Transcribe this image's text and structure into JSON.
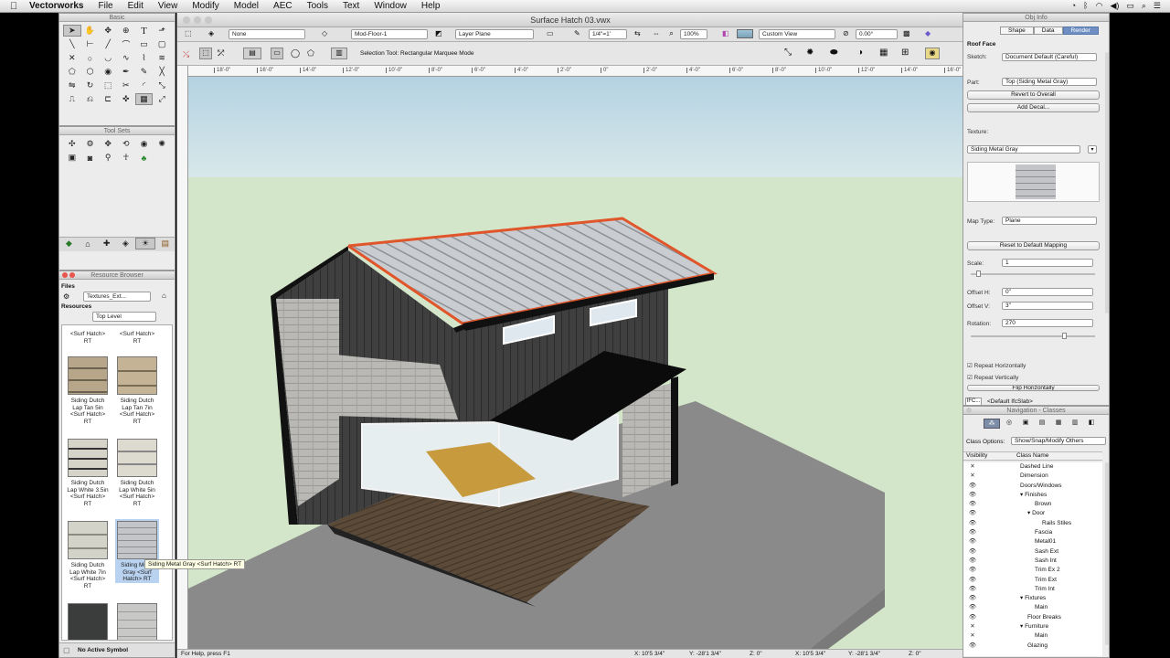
{
  "menubar": {
    "app_name": "Vectorworks",
    "items": [
      "File",
      "Edit",
      "View",
      "Modify",
      "Model",
      "AEC",
      "Tools",
      "Text",
      "Window",
      "Help"
    ]
  },
  "basic_palette": {
    "title": "Basic"
  },
  "tool_sets": {
    "title": "Tool Sets"
  },
  "resource_browser": {
    "title": "Resource Browser",
    "files_label": "Files",
    "files_value": "Textures_Ext...",
    "resources_label": "Resources",
    "resources_value": "Top Level",
    "items": [
      {
        "label": "Siding Dutch Lap Tan 5in <Surf Hatch> RT",
        "color": "#b7a68a"
      },
      {
        "label": "Siding Dutch Lap Tan 7in <Surf Hatch> RT",
        "color": "#c4b394"
      },
      {
        "label": "Siding Dutch Lap White 3.5in <Surf Hatch> RT",
        "color": "#d6d4c8"
      },
      {
        "label": "Siding Dutch Lap White 5in <Surf Hatch> RT",
        "color": "#dddbd0"
      },
      {
        "label": "Siding Dutch Lap White 7in <Surf Hatch> RT",
        "color": "#d4d3c9"
      },
      {
        "label": "Siding Metal Gray <Surf Hatch> RT",
        "color": "#bfc1c4"
      }
    ],
    "top_partial": "<Surf Hatch> RT",
    "tooltip": "Siding Metal Gray <Surf Hatch> RT",
    "active_symbol": "No Active Symbol"
  },
  "document": {
    "title": "Surface Hatch 03.vwx",
    "class_field": "None",
    "layer_field": "Mod-Floor-1",
    "plane_field": "Layer Plane",
    "scale_field": "1/4\"=1'",
    "zoom_field": "100%",
    "view_field": "Custom View",
    "angle_field": "0.00°",
    "mode_text": "Selection Tool: Rectangular Marquee Mode",
    "ruler_ticks": [
      "18'-0\"",
      "16'-0\"",
      "14'-0\"",
      "12'-0\"",
      "10'-0\"",
      "8'-0\"",
      "6'-0\"",
      "4'-0\"",
      "2'-0\"",
      "0\"",
      "2'-0\"",
      "4'-0\"",
      "6'-0\"",
      "8'-0\"",
      "10'-0\"",
      "12'-0\"",
      "14'-0\"",
      "16'-0\""
    ],
    "status_help": "For Help, press F1",
    "status_x": "X: 10'5 3/4\"",
    "status_y": "Y: -28'1 3/4\"",
    "status_z": "Z: 0\"",
    "status_x2": "X: 10'5 3/4\"",
    "status_y2": "Y: -28'1 3/4\"",
    "status_z2": "Z: 0\""
  },
  "obj_info": {
    "title": "Obj Info",
    "tabs": [
      "Shape",
      "Data",
      "Render"
    ],
    "object_type": "Roof Face",
    "sketch_label": "Sketch:",
    "sketch_value": "Document Default (Careful)",
    "part_label": "Part:",
    "part_value": "Top (Siding Metal Gray)",
    "revert_button": "Revert to Overall",
    "add_decal_button": "Add Decal...",
    "texture_label": "Texture:",
    "texture_value": "Siding Metal Gray",
    "map_type_label": "Map Type:",
    "map_type_value": "Plane",
    "reset_button": "Reset to Default Mapping",
    "scale_label": "Scale:",
    "scale_value": "1",
    "offset_h_label": "Offset H:",
    "offset_h_value": "0\"",
    "offset_v_label": "Offset V:",
    "offset_v_value": "3\"",
    "rotation_label": "Rotation:",
    "rotation_value": "270",
    "repeat_h": "Repeat Horizontally",
    "repeat_v": "Repeat Vertically",
    "flip_h": "Flip Horizontally",
    "ifc_label": "IFC...",
    "ifc_value": "<Default IfcSlab>"
  },
  "navigation": {
    "title": "Navigation - Classes",
    "class_options_label": "Class Options:",
    "class_options_value": "Show/Snap/Modify Others",
    "col_visibility": "Visibility",
    "col_class_name": "Class Name",
    "rows": [
      {
        "vis": "✕",
        "name": "Dashed Line",
        "indent": 0
      },
      {
        "vis": "✕",
        "name": "Dimension",
        "indent": 0
      },
      {
        "vis": "👁",
        "name": "Doors/Windows",
        "indent": 0
      },
      {
        "vis": "👁",
        "name": "▾ Finishes",
        "indent": 0
      },
      {
        "vis": "👁",
        "name": "Brown",
        "indent": 2
      },
      {
        "vis": "👁",
        "name": "▾ Door",
        "indent": 1
      },
      {
        "vis": "👁",
        "name": "Rails Stiles",
        "indent": 3
      },
      {
        "vis": "👁",
        "name": "Fascia",
        "indent": 2
      },
      {
        "vis": "👁",
        "name": "Metal01",
        "indent": 2
      },
      {
        "vis": "👁",
        "name": "Sash Ext",
        "indent": 2
      },
      {
        "vis": "👁",
        "name": "Sash Int",
        "indent": 2
      },
      {
        "vis": "👁",
        "name": "Trim Ex 2",
        "indent": 2
      },
      {
        "vis": "👁",
        "name": "Trim Ext",
        "indent": 2
      },
      {
        "vis": "👁",
        "name": "Trim Int",
        "indent": 2
      },
      {
        "vis": "👁",
        "name": "▾ Fixtures",
        "indent": 0
      },
      {
        "vis": "👁",
        "name": "Main",
        "indent": 2
      },
      {
        "vis": "👁",
        "name": "Floor Breaks",
        "indent": 1
      },
      {
        "vis": "✕",
        "name": "▾ Furniture",
        "indent": 0
      },
      {
        "vis": "✕",
        "name": "Main",
        "indent": 2
      },
      {
        "vis": "👁",
        "name": "Glazing",
        "indent": 1
      }
    ]
  }
}
